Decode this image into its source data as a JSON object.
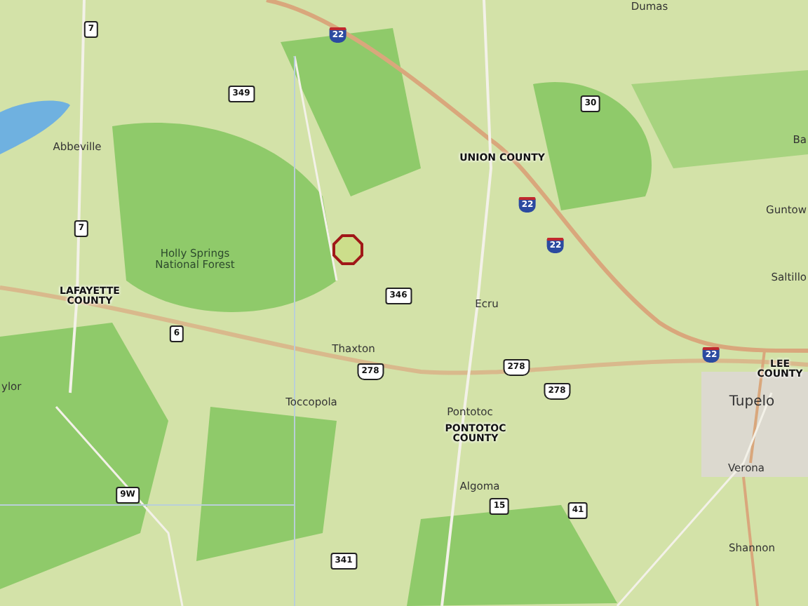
{
  "map": {
    "places": [
      {
        "name": "Dumas",
        "kind": "town"
      },
      {
        "name": "Ba",
        "kind": "town"
      },
      {
        "name": "UNION COUNTY",
        "kind": "county"
      },
      {
        "name": "Abbeville",
        "kind": "town"
      },
      {
        "name": "Guntow",
        "kind": "town"
      },
      {
        "name": "Holly Springs National Forest",
        "kind": "forest"
      },
      {
        "name": "Saltillo",
        "kind": "town"
      },
      {
        "name": "LAFAYETTE COUNTY",
        "kind": "county"
      },
      {
        "name": "Ecru",
        "kind": "town"
      },
      {
        "name": "Thaxton",
        "kind": "town"
      },
      {
        "name": "LEE COUNTY",
        "kind": "county"
      },
      {
        "name": "ylor",
        "kind": "town"
      },
      {
        "name": "Tupelo",
        "kind": "city"
      },
      {
        "name": "Toccopola",
        "kind": "town"
      },
      {
        "name": "Pontotoc",
        "kind": "town"
      },
      {
        "name": "PONTOTOC COUNTY",
        "kind": "county"
      },
      {
        "name": "Verona",
        "kind": "town"
      },
      {
        "name": "Algoma",
        "kind": "town"
      },
      {
        "name": "Shannon",
        "kind": "town"
      }
    ],
    "shields": [
      {
        "number": "7",
        "kind": "state"
      },
      {
        "number": "22",
        "kind": "interstate"
      },
      {
        "number": "349",
        "kind": "state"
      },
      {
        "number": "30",
        "kind": "state"
      },
      {
        "number": "22",
        "kind": "interstate"
      },
      {
        "number": "7",
        "kind": "state"
      },
      {
        "number": "22",
        "kind": "interstate"
      },
      {
        "number": "346",
        "kind": "state"
      },
      {
        "number": "6",
        "kind": "state"
      },
      {
        "number": "22",
        "kind": "interstate"
      },
      {
        "number": "278",
        "kind": "us"
      },
      {
        "number": "278",
        "kind": "us"
      },
      {
        "number": "278",
        "kind": "us"
      },
      {
        "number": "9W",
        "kind": "state"
      },
      {
        "number": "15",
        "kind": "state"
      },
      {
        "number": "41",
        "kind": "state"
      },
      {
        "number": "341",
        "kind": "state"
      }
    ],
    "marker": {
      "kind": "octagon"
    }
  }
}
